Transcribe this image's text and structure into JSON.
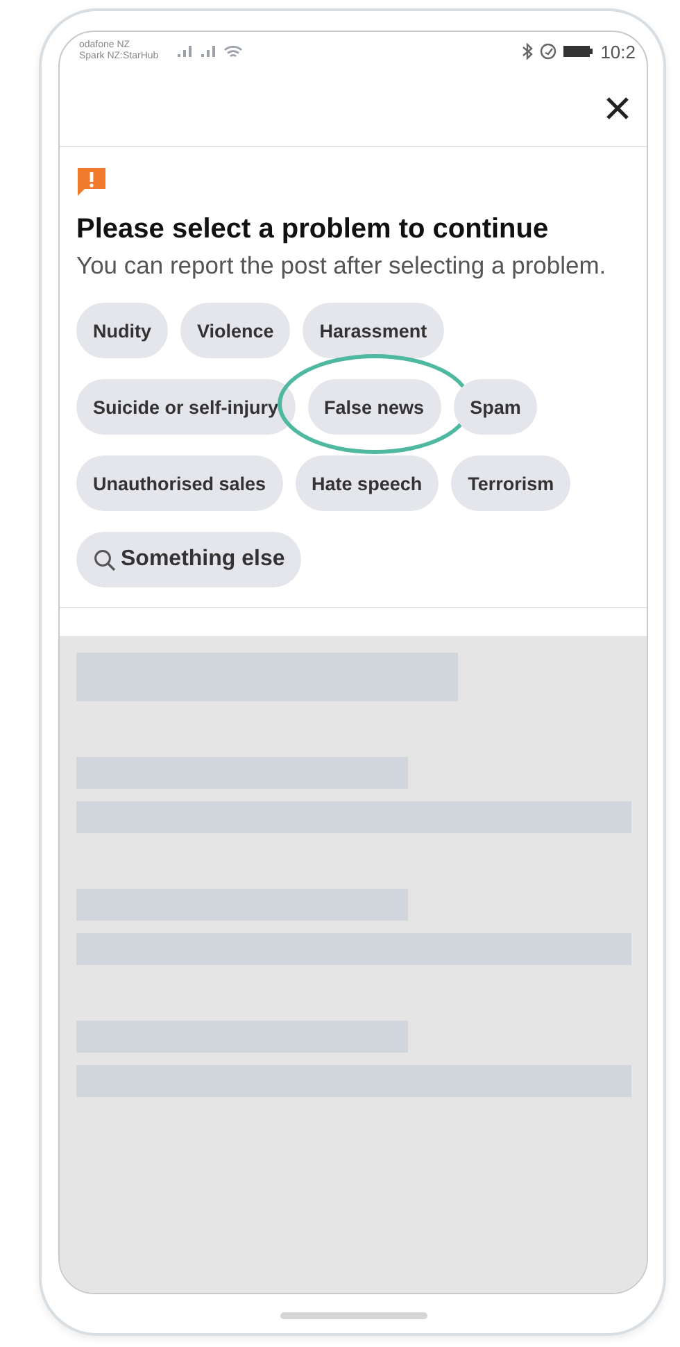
{
  "status_bar": {
    "carriers": [
      "odafone NZ",
      "Spark NZ:StarHub"
    ],
    "time": "10:2"
  },
  "dialog": {
    "title": "Please select a problem to continue",
    "subtitle": "You can report the post after selecting a problem.",
    "options": [
      {
        "label": "Nudity",
        "kind": "chip",
        "highlighted": false
      },
      {
        "label": "Violence",
        "kind": "chip",
        "highlighted": false
      },
      {
        "label": "Harassment",
        "kind": "chip",
        "highlighted": false
      },
      {
        "label": "Suicide or self-injury",
        "kind": "chip",
        "highlighted": false
      },
      {
        "label": "False news",
        "kind": "chip",
        "highlighted": true
      },
      {
        "label": "Spam",
        "kind": "chip",
        "highlighted": false
      },
      {
        "label": "Unauthorised sales",
        "kind": "chip",
        "highlighted": false
      },
      {
        "label": "Hate speech",
        "kind": "chip",
        "highlighted": false
      },
      {
        "label": "Terrorism",
        "kind": "chip",
        "highlighted": false
      },
      {
        "label": "Something else",
        "kind": "search",
        "highlighted": false
      }
    ]
  }
}
